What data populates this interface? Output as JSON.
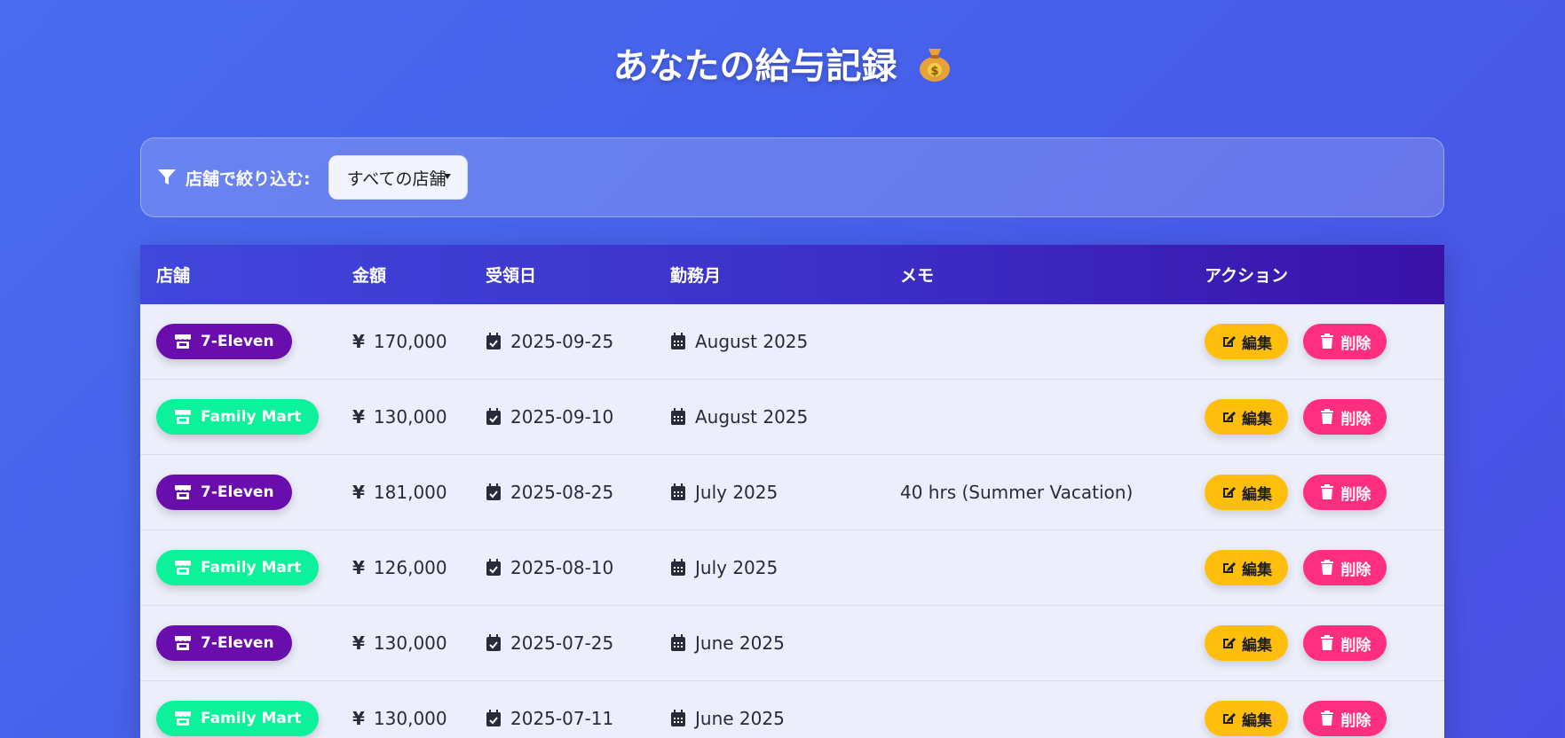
{
  "title": "あなたの給与記録",
  "icons": {
    "title": "moneybag-icon",
    "filter": "filter-icon",
    "store": "store-icon",
    "date": "calendar-check-icon",
    "month": "calendar-icon",
    "edit": "edit-icon",
    "delete": "trash-icon"
  },
  "filter": {
    "label": "店舗で絞り込む:",
    "selected": "すべての店舗"
  },
  "table": {
    "headers": [
      "店舗",
      "金額",
      "受領日",
      "勤務月",
      "メモ",
      "アクション"
    ],
    "currency_symbol": "¥",
    "edit_label": "編集",
    "delete_label": "削除",
    "rows": [
      {
        "store": "7-Eleven",
        "store_color": "#6a0dad",
        "amount": "170,000",
        "received": "2025-09-25",
        "month": "August 2025",
        "memo": ""
      },
      {
        "store": "Family Mart",
        "store_color": "#0cf29a",
        "amount": "130,000",
        "received": "2025-09-10",
        "month": "August 2025",
        "memo": ""
      },
      {
        "store": "7-Eleven",
        "store_color": "#6a0dad",
        "amount": "181,000",
        "received": "2025-08-25",
        "month": "July 2025",
        "memo": "40 hrs (Summer Vacation)"
      },
      {
        "store": "Family Mart",
        "store_color": "#0cf29a",
        "amount": "126,000",
        "received": "2025-08-10",
        "month": "July 2025",
        "memo": ""
      },
      {
        "store": "7-Eleven",
        "store_color": "#6a0dad",
        "amount": "130,000",
        "received": "2025-07-25",
        "month": "June 2025",
        "memo": ""
      },
      {
        "store": "Family Mart",
        "store_color": "#0cf29a",
        "amount": "130,000",
        "received": "2025-07-11",
        "month": "June 2025",
        "memo": ""
      }
    ]
  },
  "colors": {
    "edit": "#ffbe0b",
    "delete": "#ff2e7e"
  }
}
